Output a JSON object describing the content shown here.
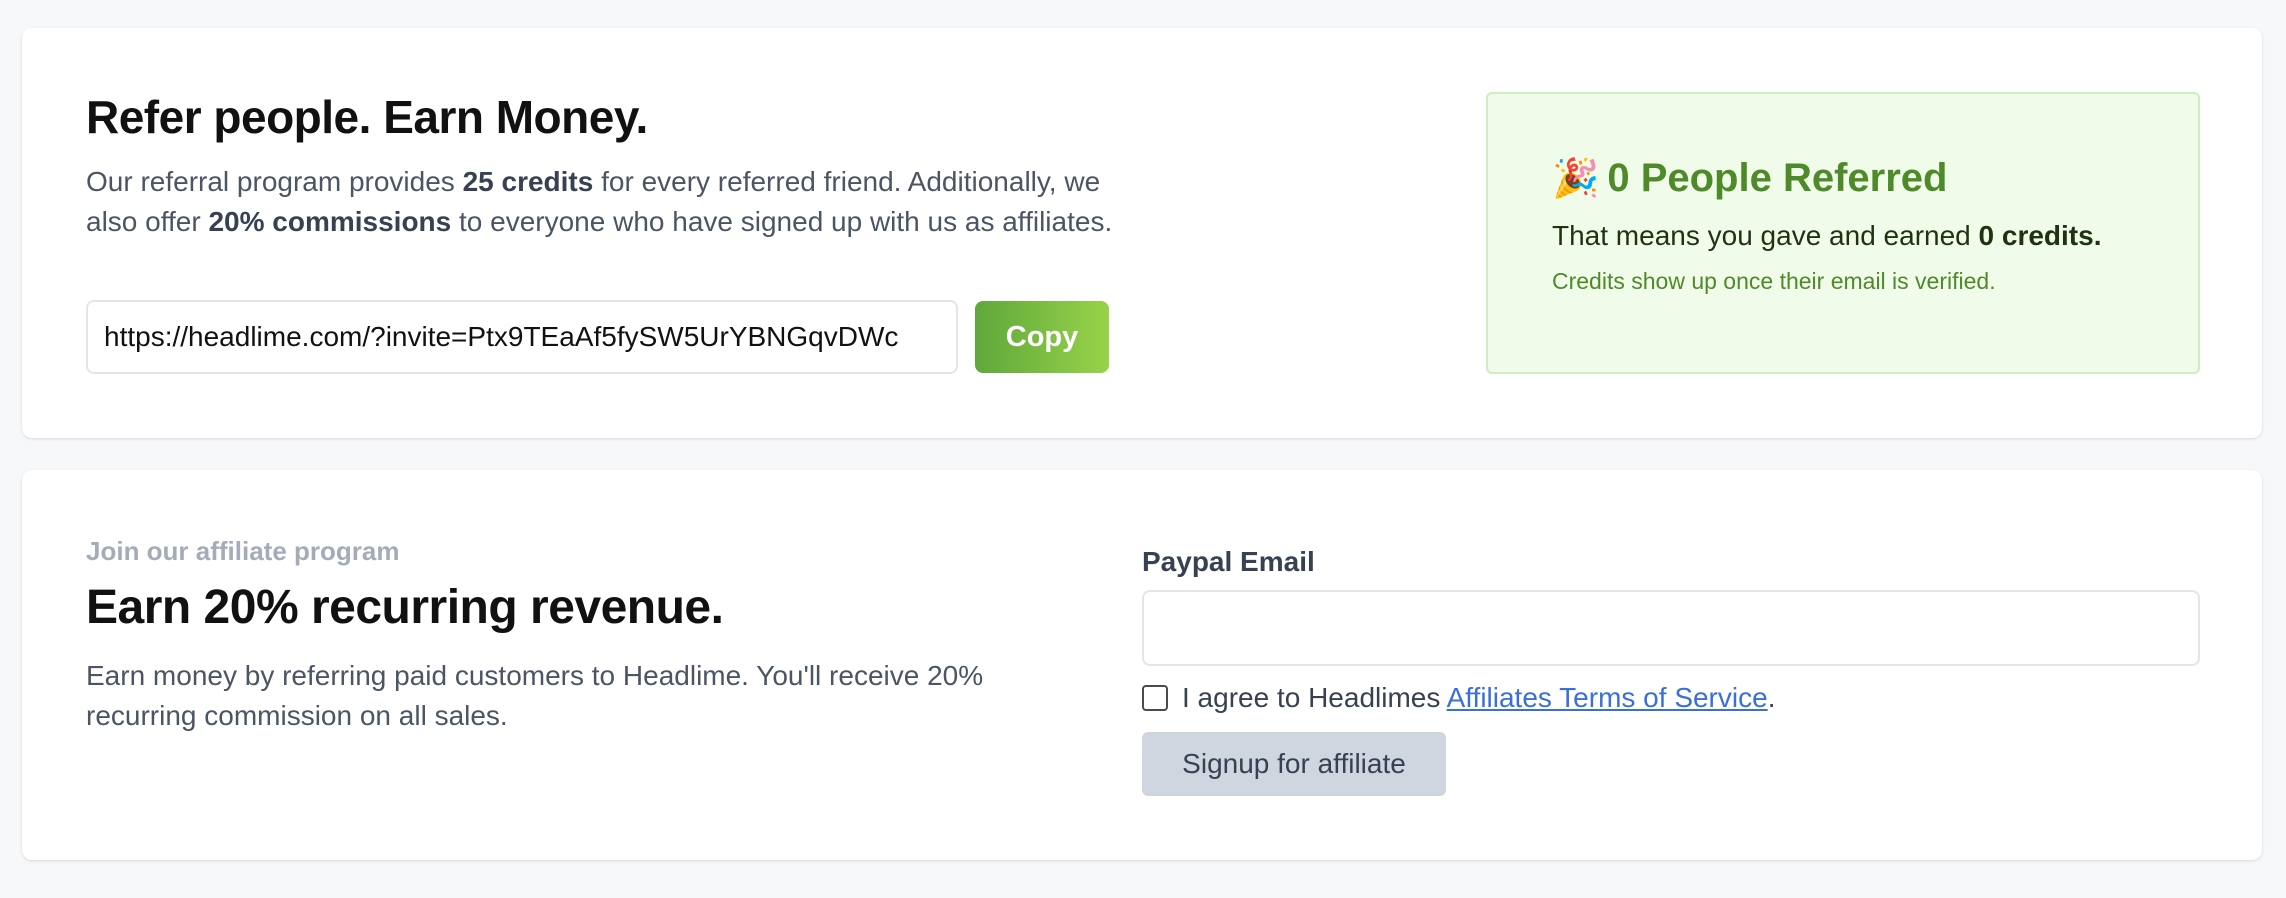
{
  "referral": {
    "title": "Refer people. Earn Money.",
    "desc_part1": "Our referral program provides ",
    "desc_bold1": "25 credits",
    "desc_part2": " for every referred friend. Additionally, we also offer ",
    "desc_bold2": "20% commissions",
    "desc_part3": " to everyone who have signed up with us as affiliates.",
    "invite_link": "https://headlime.com/?invite=Ptx9TEaAf5fySW5UrYBNGqvDWc",
    "copy_label": "Copy"
  },
  "stats": {
    "icon": "party-popper-icon",
    "title": "0 People Referred",
    "line_part1": "That means you gave and earned ",
    "line_bold": "0 credits.",
    "note": "Credits show up once their email is verified."
  },
  "affiliate": {
    "eyebrow": "Join our affiliate program",
    "title": "Earn 20% recurring revenue.",
    "desc": "Earn money by referring paid customers to Headlime. You'll receive 20% recurring commission on all sales.",
    "paypal_label": "Paypal Email",
    "paypal_value": "",
    "agree_text": "I agree to Headlimes ",
    "tos_link": "Affiliates Terms of Service",
    "agree_period": ".",
    "signup_label": "Signup for affiliate"
  },
  "colors": {
    "page_bg": "#f7f8fa",
    "accent_green": "#4e8a2a",
    "copy_gradient_start": "#5fa83a",
    "copy_gradient_end": "#98d24a",
    "stats_bg": "#f1fbe9",
    "link_blue": "#3b6fd8",
    "signup_bg": "#cfd6e0"
  }
}
